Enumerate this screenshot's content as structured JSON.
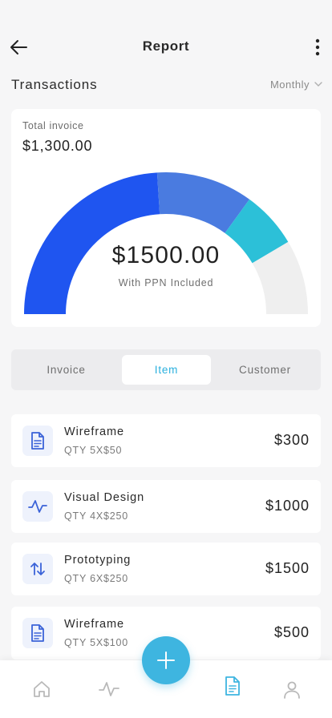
{
  "header": {
    "title": "Report",
    "back_icon": "arrow-left-icon",
    "more_icon": "more-vertical-icon"
  },
  "transactions": {
    "title": "Transactions",
    "period": "Monthly"
  },
  "invoice_card": {
    "label": "Total invoice",
    "amount": "$1,300.00"
  },
  "gauge": {
    "total": "$1500.00",
    "subtitle": "With PPN Included",
    "segments": [
      {
        "color": "#1f55f0",
        "fraction": 0.48
      },
      {
        "color": "#4a7be0",
        "fraction": 0.22
      },
      {
        "color": "#2cc0d8",
        "fraction": 0.13
      },
      {
        "color": "#efefef",
        "fraction": 0.17
      }
    ]
  },
  "tabs": [
    {
      "label": "Invoice",
      "active": false
    },
    {
      "label": "Item",
      "active": true
    },
    {
      "label": "Customer",
      "active": false
    }
  ],
  "items": [
    {
      "name": "Wireframe",
      "qty": "QTY 5X$50",
      "price": "$300",
      "icon": "document-icon"
    },
    {
      "name": "Visual Design",
      "qty": "QTY 4X$250",
      "price": "$1000",
      "icon": "pulse-icon"
    },
    {
      "name": "Prototyping",
      "qty": "QTY 6X$250",
      "price": "$1500",
      "icon": "swap-vertical-icon"
    },
    {
      "name": "Wireframe",
      "qty": "QTY 5X$100",
      "price": "$500",
      "icon": "document-icon"
    }
  ],
  "bottom_nav": {
    "items": [
      "home-icon",
      "activity-icon",
      "document-icon",
      "user-icon"
    ],
    "fab_icon": "plus-icon",
    "active_color": "#3eb5e0",
    "inactive_color": "#b9b9b9"
  }
}
